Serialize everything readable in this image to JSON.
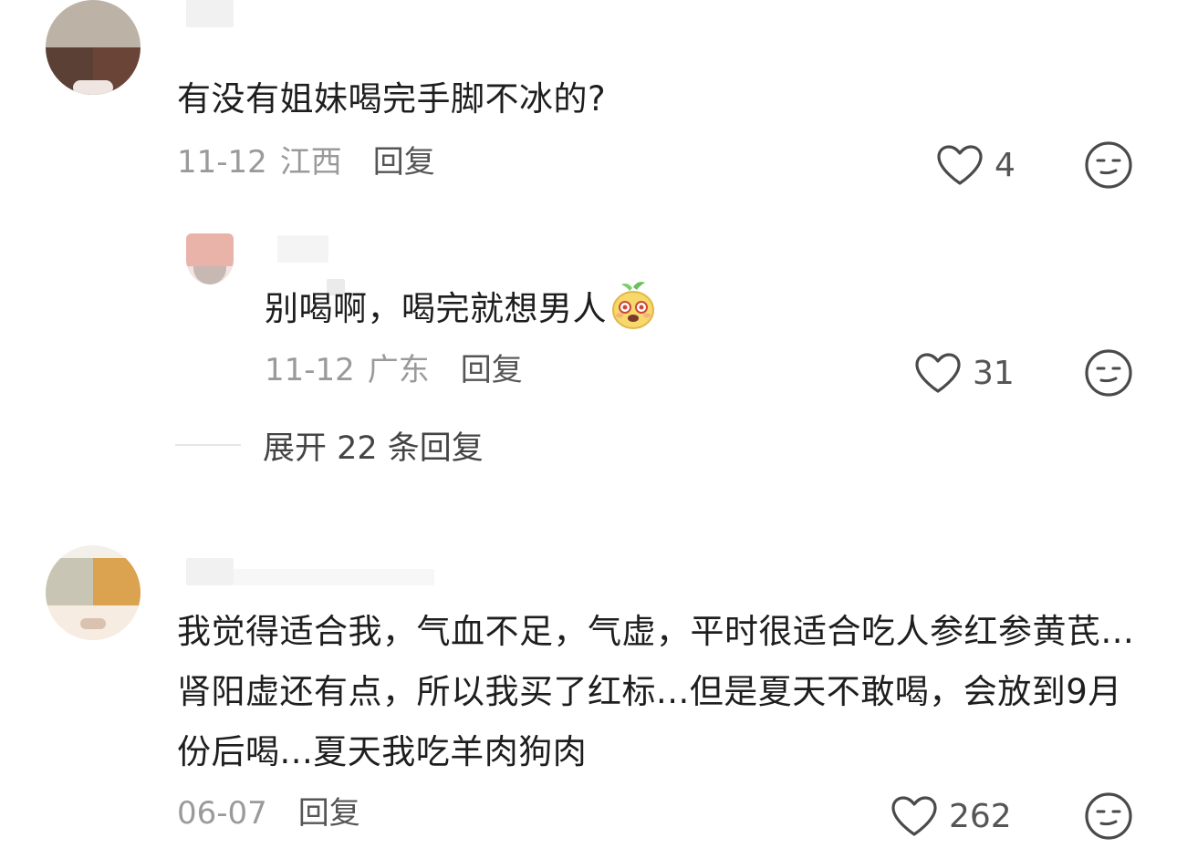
{
  "comments": [
    {
      "text": "有没有姐妹喝完手脚不冰的?",
      "date": "11-12",
      "location": "江西",
      "reply_label": "回复",
      "likes": "4",
      "replies": [
        {
          "text": "别喝啊，喝完就想男人",
          "emoji": "mango-face-emoji",
          "date": "11-12",
          "location": "广东",
          "reply_label": "回复",
          "likes": "31"
        }
      ],
      "expand_label": "展开 22 条回复"
    },
    {
      "text": "我觉得适合我，气血不足，气虚，平时很适合吃人参红参黄芪... 肾阳虚还有点，所以我买了红标...但是夏天不敢喝，会放到9月份后喝...夏天我吃羊肉狗肉",
      "date": "06-07",
      "reply_label": "回复",
      "likes": "262"
    }
  ],
  "icons": {
    "like": "heart-outline-icon",
    "dislike": "meh-face-icon"
  },
  "colors": {
    "text": "#1e1e1e",
    "meta": "#9a9a9a",
    "action": "#555555",
    "icon": "#4a4a4a"
  }
}
